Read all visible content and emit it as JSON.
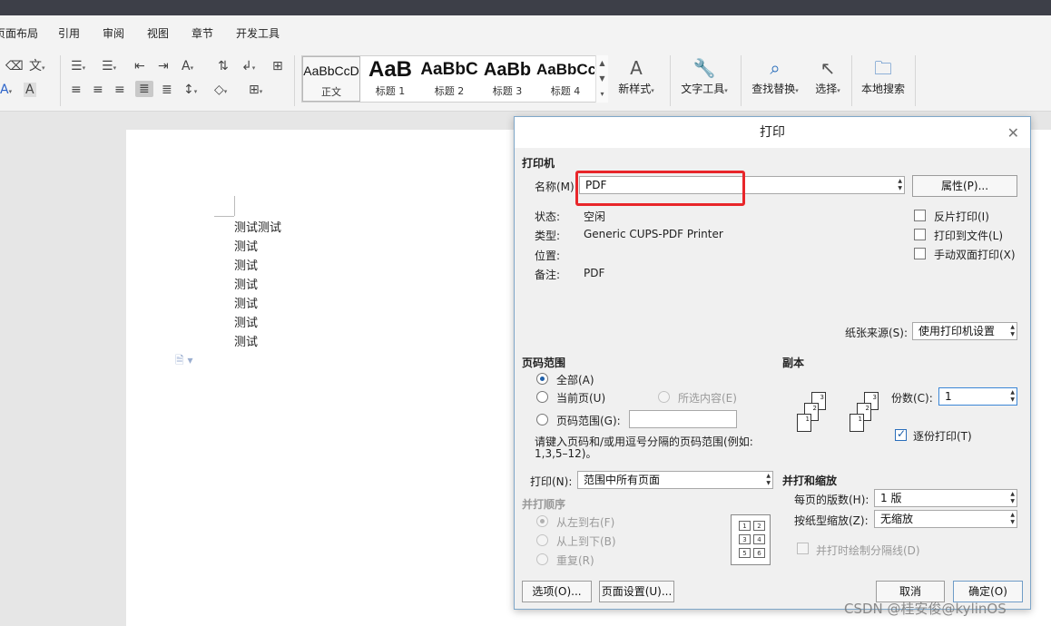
{
  "menubar": {
    "items": [
      "页面布局",
      "引用",
      "审阅",
      "视图",
      "章节",
      "开发工具"
    ]
  },
  "ribbon": {
    "styles": [
      {
        "preview": "AaBbCcD",
        "label": "正文"
      },
      {
        "preview": "AaB",
        "label": "标题 1"
      },
      {
        "preview": "AaBbC",
        "label": "标题 2"
      },
      {
        "preview": "AaBb",
        "label": "标题 3"
      },
      {
        "preview": "AaBbCc",
        "label": "标题 4"
      }
    ],
    "buttons": {
      "new_style": "新样式",
      "text_tools": "文字工具",
      "find_replace": "查找替换",
      "select": "选择",
      "local_search": "本地搜索"
    }
  },
  "document": {
    "lines": [
      "测试测试",
      "测试",
      "测试",
      "测试",
      "测试",
      "测试",
      "测试"
    ]
  },
  "dialog": {
    "title": "打印",
    "printer": {
      "section": "打印机",
      "name_label": "名称(M):",
      "name_value": "PDF",
      "properties_button": "属性(P)...",
      "status_label": "状态:",
      "status_value": "空闲",
      "type_label": "类型:",
      "type_value": "Generic CUPS-PDF Printer",
      "location_label": "位置:",
      "location_value": "",
      "comment_label": "备注:",
      "comment_value": "PDF",
      "reverse_print": "反片打印(I)",
      "print_to_file": "打印到文件(L)",
      "manual_duplex": "手动双面打印(X)",
      "paper_source_label": "纸张来源(S):",
      "paper_source_value": "使用打印机设置"
    },
    "page_range": {
      "section": "页码范围",
      "all": "全部(A)",
      "current": "当前页(U)",
      "selection": "所选内容(E)",
      "range": "页码范围(G):",
      "range_value": "",
      "hint_line1": "请键入页码和/或用逗号分隔的页码范围(例如:",
      "hint_line2": "1,3,5–12)。",
      "print_label": "打印(N):",
      "print_value": "范围中所有页面"
    },
    "collate_order": {
      "section": "并打顺序",
      "left_to_right": "从左到右(F)",
      "top_to_bottom": "从上到下(B)",
      "repeat": "重复(R)",
      "cells": [
        "1",
        "2",
        "3",
        "4",
        "5",
        "6"
      ]
    },
    "copies": {
      "section": "副本",
      "count_label": "份数(C):",
      "count_value": "1",
      "collate": "逐份打印(T)",
      "icon_numbers": [
        "3",
        "2",
        "1"
      ]
    },
    "zoom": {
      "section": "并打和缩放",
      "pages_per_sheet_label": "每页的版数(H):",
      "pages_per_sheet_value": "1 版",
      "scale_label": "按纸型缩放(Z):",
      "scale_value": "无缩放",
      "draw_borders": "并打时绘制分隔线(D)"
    },
    "buttons": {
      "options": "选项(O)...",
      "page_setup": "页面设置(U)...",
      "cancel": "取消",
      "ok": "确定(O)"
    }
  },
  "watermark": "CSDN @桂安俊@kylinOS"
}
